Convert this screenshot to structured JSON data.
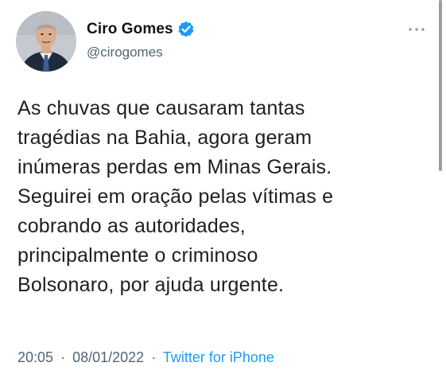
{
  "tweet": {
    "author": {
      "display_name": "Ciro Gomes",
      "handle": "@cirogomes",
      "verified": true,
      "avatar_icon": "profile-photo-man-in-suit"
    },
    "text": "As chuvas que causaram tantas\ntragédias na Bahia, agora geram\ninúmeras perdas em Minas Gerais.\nSeguirei em oração pelas vítimas e\ncobrando as autoridades,\nprincipalmente o criminoso\nBolsonaro, por ajuda urgente.",
    "time": "20:05",
    "date": "08/01/2022",
    "separator": "·",
    "source": "Twitter for iPhone"
  },
  "icons": {
    "more": "more-horizontal-icon",
    "verified": "verified-badge-icon"
  },
  "colors": {
    "accent": "#1d9bf0",
    "text_primary": "#0f1419",
    "text_secondary": "#536471",
    "background": "#ffffff",
    "scrollbar": "#9e9e9e"
  }
}
